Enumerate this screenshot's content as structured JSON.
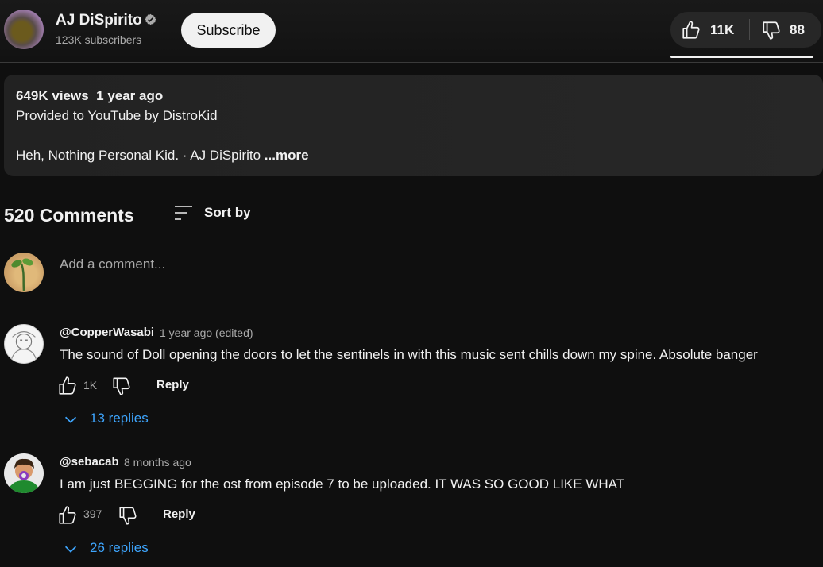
{
  "channel": {
    "name": "AJ DiSpirito",
    "subscribers": "123K subscribers",
    "subscribe_label": "Subscribe",
    "verified_icon": "verified-badge-icon"
  },
  "ratings": {
    "likes": "11K",
    "dislikes": "88"
  },
  "description": {
    "views": "649K views",
    "age": "1 year ago",
    "provided": "Provided to YouTube by DistroKid",
    "song_line": "Heh, Nothing Personal Kid. · AJ DiSpirito",
    "song_fade": "",
    "more_label": "...more"
  },
  "comments": {
    "count_label": "520 Comments",
    "sort_label": "Sort by",
    "add_placeholder": "Add a comment...",
    "items": [
      {
        "author": "@CopperWasabi",
        "time": "1 year ago (edited)",
        "text": "The sound of Doll opening the doors to let the sentinels in with this music sent chills down my spine. Absolute banger",
        "likes": "1K",
        "reply_label": "Reply",
        "replies_label": "13 replies"
      },
      {
        "author": "@sebacab",
        "time": "8 months ago",
        "text": "I am just BEGGING for the ost from episode 7 to be uploaded. IT WAS SO GOOD LIKE WHAT",
        "likes": "397",
        "reply_label": "Reply",
        "replies_label": "26 replies"
      }
    ]
  },
  "colors": {
    "background": "#0f0f0f",
    "accent_link": "#3ea6ff",
    "text": "#f1f1f1",
    "muted": "#aaaaaa"
  }
}
